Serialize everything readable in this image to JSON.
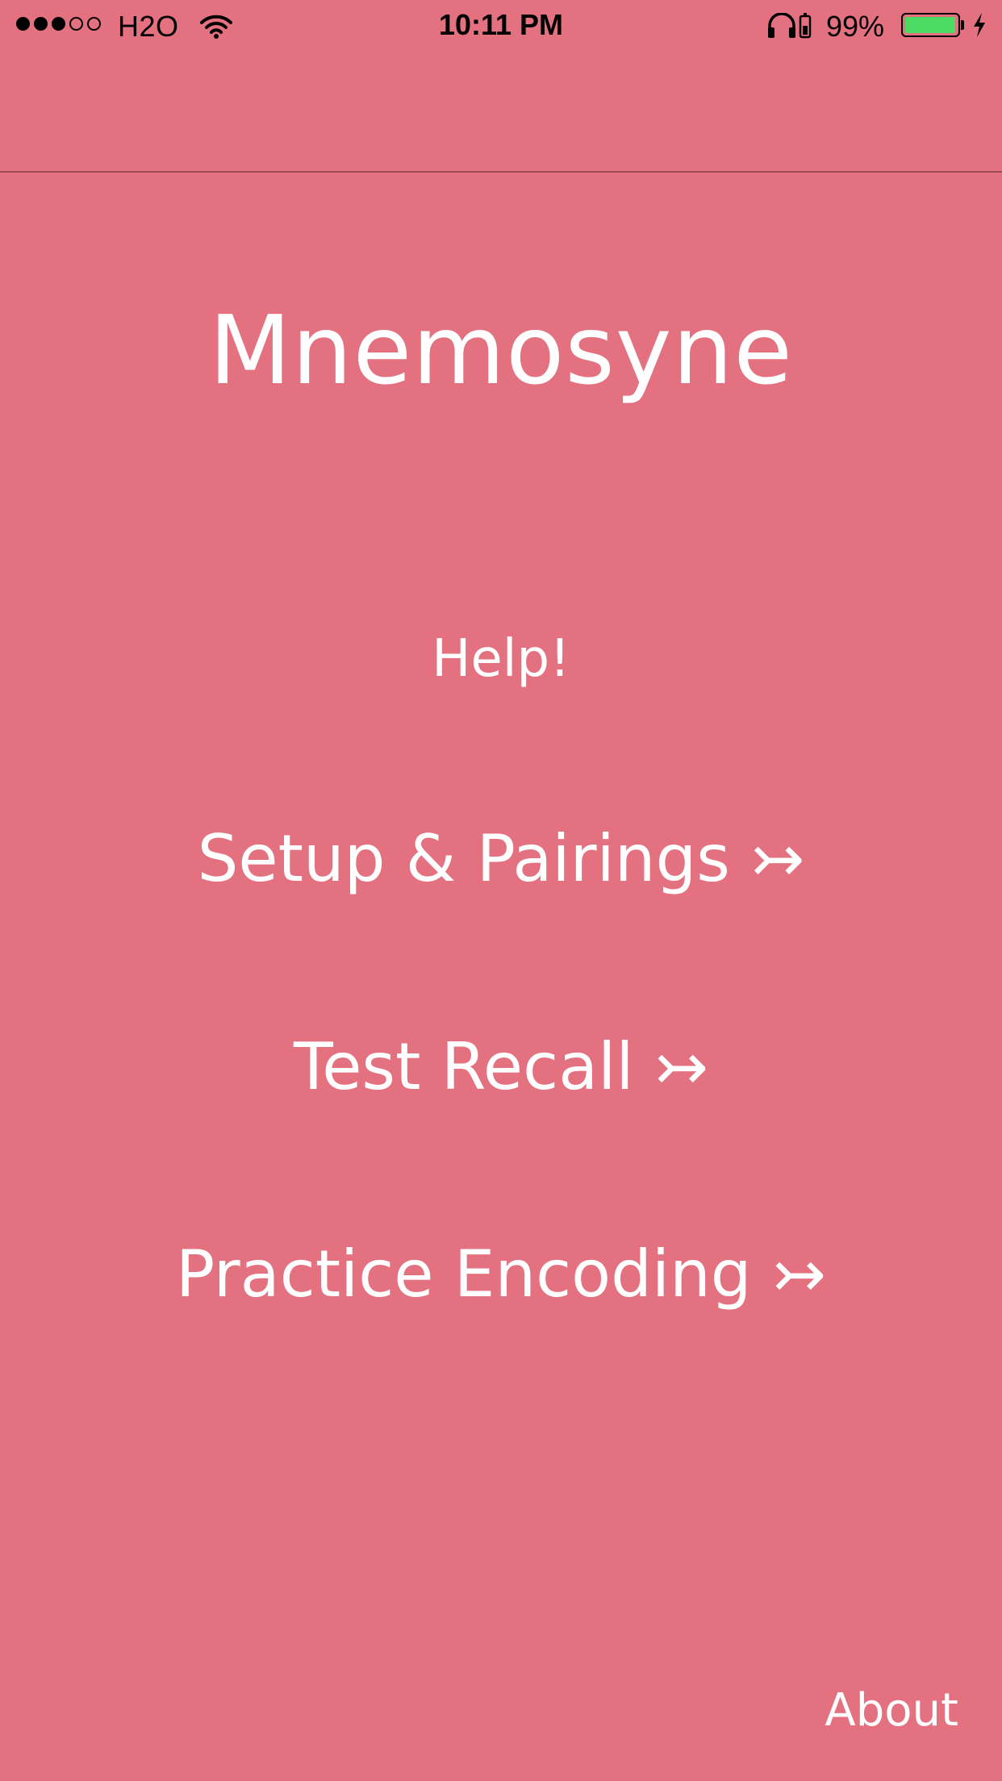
{
  "status_bar": {
    "signal_bars_filled": 3,
    "signal_bars_total": 5,
    "carrier": "H2O",
    "time": "10:11 PM",
    "battery_percent": "99%",
    "battery_level": 0.99,
    "battery_color": "#4cd964",
    "icons": [
      "wifi-icon",
      "headphones-icon",
      "rotation-lock-icon",
      "battery-icon",
      "charging-icon"
    ]
  },
  "app": {
    "title": "Mnemosyne",
    "background_color": "#e3717f"
  },
  "menu": {
    "help": "Help!",
    "setup": "Setup & Pairings ↣",
    "test": "Test Recall ↣",
    "practice": "Practice Encoding ↣"
  },
  "footer": {
    "about": "About"
  }
}
